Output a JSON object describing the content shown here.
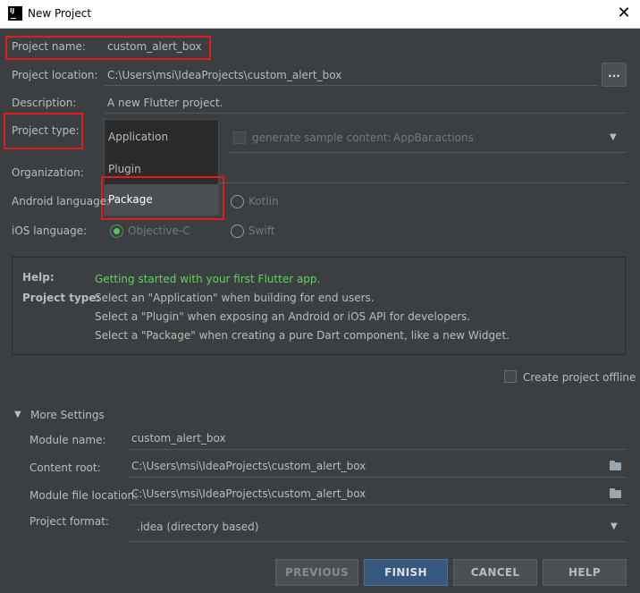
{
  "window": {
    "title": "New Project",
    "close_glyph": "✕"
  },
  "form": {
    "project_name": {
      "label": "Project name:",
      "value": "custom_alert_box"
    },
    "project_location": {
      "label": "Project location:",
      "value": "C:\\Users\\msi\\IdeaProjects\\custom_alert_box",
      "browse_label": "..."
    },
    "description": {
      "label": "Description:",
      "value": "A new Flutter project."
    },
    "project_type": {
      "label": "Project type:",
      "options": [
        "Application",
        "Plugin",
        "Package"
      ],
      "selected": "Package"
    },
    "sample_content": {
      "label": "generate sample content:",
      "value": "AppBar.actions",
      "checked": false
    },
    "organization": {
      "label": "Organization:"
    },
    "android_language": {
      "label": "Android language:",
      "option": "Kotlin"
    },
    "ios_language": {
      "label": "iOS language:",
      "options": [
        "Objective-C",
        "Swift"
      ],
      "selected": "Objective-C"
    }
  },
  "help": {
    "help_label": "Help:",
    "help_text": "Getting started with your first Flutter app.",
    "type_label": "Project type:",
    "lines": [
      "Select an \"Application\" when building for end users.",
      "Select a \"Plugin\" when exposing an Android or iOS API for developers.",
      "Select a \"Package\" when creating a pure Dart component, like a new Widget."
    ]
  },
  "offline": {
    "label": "Create project offline",
    "checked": false
  },
  "more_settings": {
    "title": "More Settings",
    "expanded": true,
    "module_name": {
      "label": "Module name:",
      "value": "custom_alert_box"
    },
    "content_root": {
      "label": "Content root:",
      "value": "C:\\Users\\msi\\IdeaProjects\\custom_alert_box"
    },
    "module_file_location": {
      "label": "Module file location:",
      "value": "C:\\Users\\msi\\IdeaProjects\\custom_alert_box"
    },
    "project_format": {
      "label": "Project format:",
      "value": ".idea (directory based)"
    }
  },
  "buttons": {
    "previous": "PREVIOUS",
    "finish": "FINISH",
    "cancel": "CANCEL",
    "help": "HELP"
  },
  "icons": {
    "dropdown": "chevron-down-icon",
    "collapse": "chevron-down-icon",
    "folder": "folder-icon"
  },
  "colors": {
    "highlight": "#e51b1b",
    "accent": "#365880",
    "help_green": "#5fd35f",
    "radio_on": "#5fbd5f"
  }
}
